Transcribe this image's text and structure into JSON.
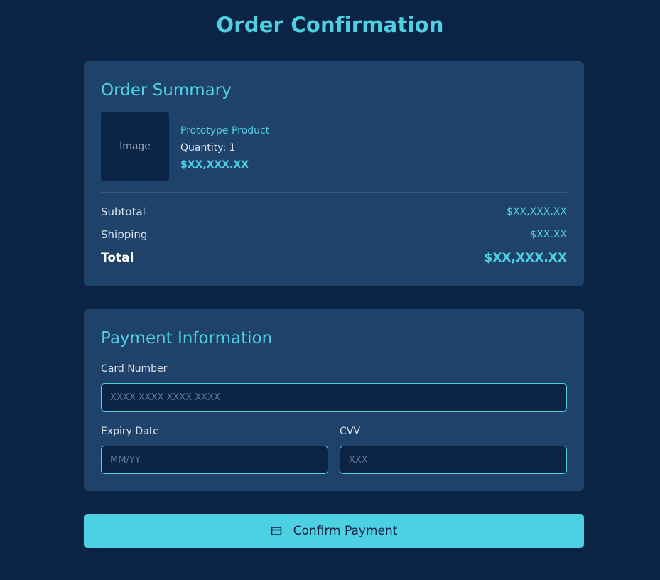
{
  "page": {
    "title": "Order Confirmation"
  },
  "summary": {
    "title": "Order Summary",
    "product": {
      "image_label": "Image",
      "name": "Prototype Product",
      "quantity": "Quantity: 1",
      "price": "$XX,XXX.XX"
    },
    "subtotal_label": "Subtotal",
    "subtotal_value": "$XX,XXX.XX",
    "shipping_label": "Shipping",
    "shipping_value": "$XX.XX",
    "total_label": "Total",
    "total_value": "$XX,XXX.XX"
  },
  "payment": {
    "title": "Payment Information",
    "card_number_label": "Card Number",
    "card_number_placeholder": "XXXX XXXX XXXX XXXX",
    "card_number_value": "",
    "expiry_label": "Expiry Date",
    "expiry_placeholder": "MM/YY",
    "expiry_value": "",
    "cvv_label": "CVV",
    "cvv_placeholder": "XXX",
    "cvv_value": ""
  },
  "confirm_button": {
    "label": "Confirm Payment",
    "icon": "credit-card-icon"
  },
  "colors": {
    "background": "#0b2344",
    "card": "#1f426b",
    "accent": "#4dd0e1",
    "text": "#d9e2ec"
  }
}
